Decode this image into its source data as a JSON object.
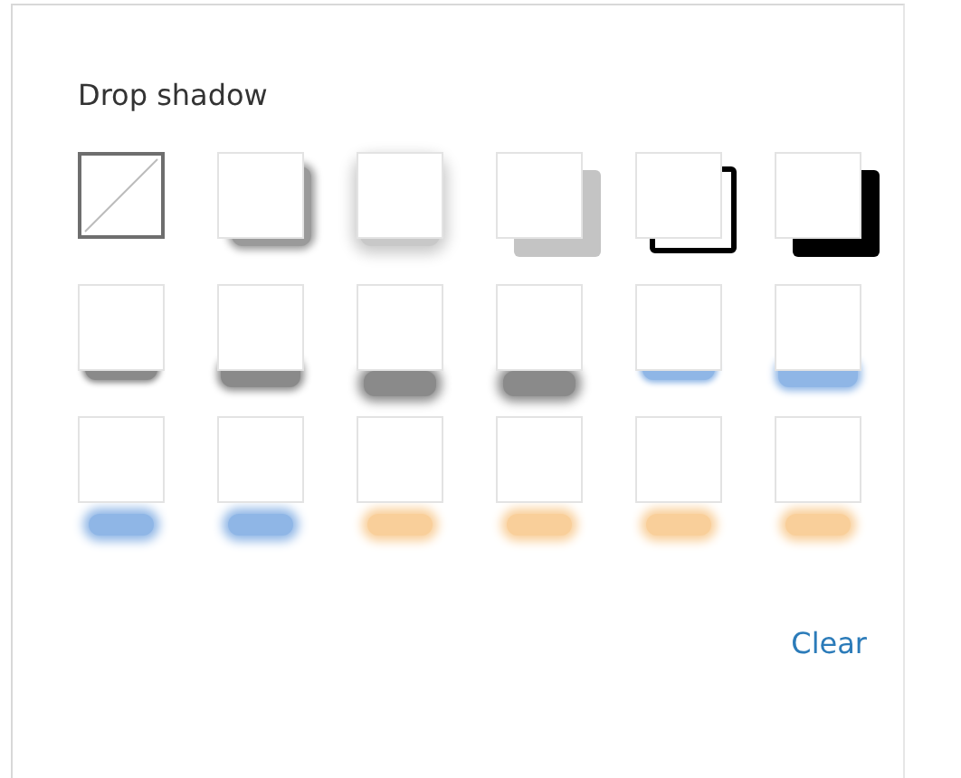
{
  "title": "Drop shadow",
  "swatches": [
    {
      "kind": "none",
      "color": "#6e6e6e"
    },
    {
      "kind": "soft-right",
      "color": "#9a9a9a"
    },
    {
      "kind": "glow",
      "color": "#c8c8c8"
    },
    {
      "kind": "offset-solid",
      "color": "#c4c4c4"
    },
    {
      "kind": "offset-outline",
      "color": "#000000"
    },
    {
      "kind": "offset-solid",
      "color": "#000000"
    },
    {
      "kind": "below",
      "color": "#8a8a8a"
    },
    {
      "kind": "below-wide",
      "color": "#8a8a8a"
    },
    {
      "kind": "below-far",
      "color": "#8a8a8a"
    },
    {
      "kind": "below-far",
      "color": "#8a8a8a"
    },
    {
      "kind": "below",
      "color": "#8fb6e6"
    },
    {
      "kind": "below-wide",
      "color": "#8fb6e6"
    },
    {
      "kind": "far-below",
      "color": "#8fb6e6"
    },
    {
      "kind": "far-below",
      "color": "#8fb6e6"
    },
    {
      "kind": "far-below",
      "color": "#f9cf9a"
    },
    {
      "kind": "far-below",
      "color": "#f9cf9a"
    },
    {
      "kind": "far-below",
      "color": "#f9cf9a"
    },
    {
      "kind": "far-below",
      "color": "#f9cf9a"
    }
  ],
  "clear_link": "Clear"
}
